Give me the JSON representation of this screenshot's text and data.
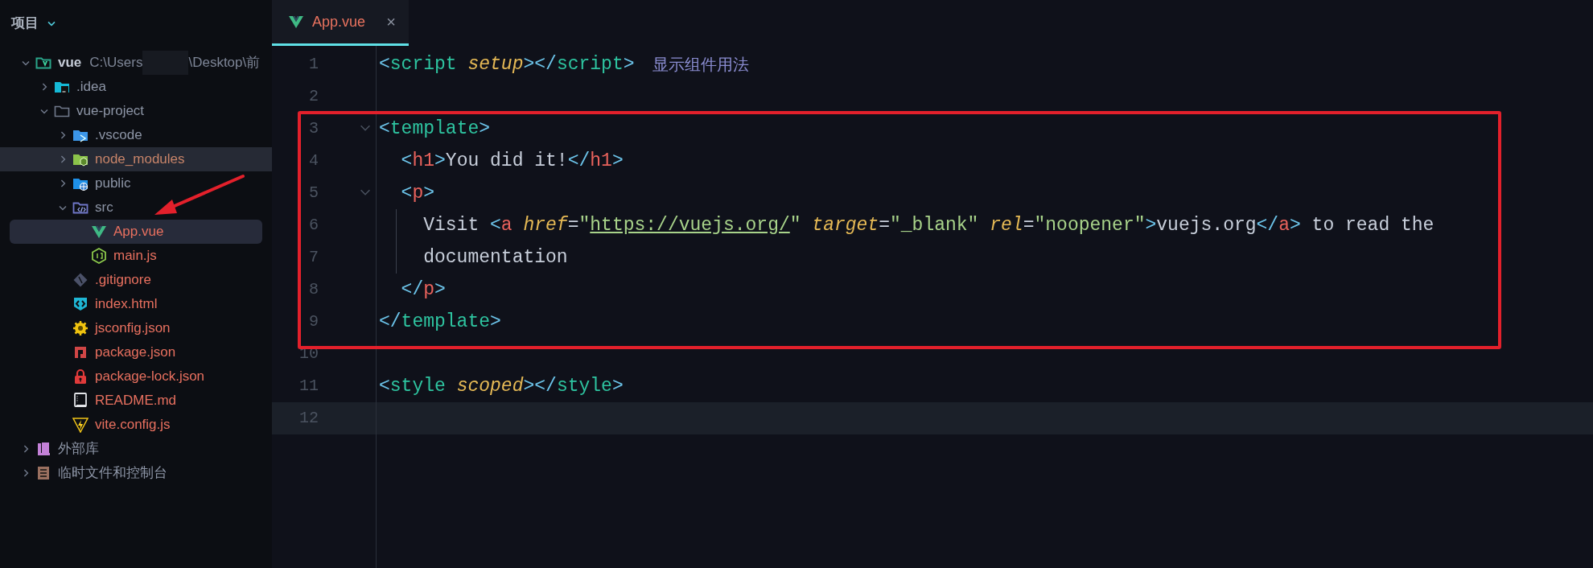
{
  "sidebar": {
    "header": {
      "title": "项目",
      "expanded": true
    },
    "tree": [
      {
        "kind": "module",
        "label": "vue",
        "path_start": "C:\\Users",
        "path_end": "\\Desktop\\前",
        "expanded": true,
        "selected": false,
        "hovered": false,
        "color": "#c4cad6",
        "children": [
          {
            "kind": "ideafolder",
            "label": ".idea",
            "expanded": false,
            "selected": false,
            "hovered": false,
            "color": "#8d95a6"
          },
          {
            "kind": "folder",
            "label": "vue-project",
            "expanded": true,
            "selected": false,
            "hovered": false,
            "color": "#8d95a6",
            "children": [
              {
                "kind": "vscodefolder",
                "label": ".vscode",
                "expanded": false,
                "selected": false,
                "hovered": false,
                "color": "#8d95a6"
              },
              {
                "kind": "nodefolder",
                "label": "node_modules",
                "expanded": false,
                "selected": false,
                "hovered": true,
                "color": "#c78469"
              },
              {
                "kind": "webfolder",
                "label": "public",
                "expanded": false,
                "selected": false,
                "hovered": false,
                "color": "#8d95a6"
              },
              {
                "kind": "srcfolder",
                "label": "src",
                "expanded": true,
                "selected": false,
                "hovered": false,
                "color": "#8d95a6",
                "children": [
                  {
                    "kind": "vue",
                    "label": "App.vue",
                    "selected": true,
                    "color": "#e8705f"
                  },
                  {
                    "kind": "js",
                    "label": "main.js",
                    "selected": false,
                    "hovered": false,
                    "color": "#e8705f"
                  }
                ]
              },
              {
                "kind": "git",
                "label": ".gitignore",
                "selected": false,
                "hovered": false,
                "color": "#e8705f"
              },
              {
                "kind": "html",
                "label": "index.html",
                "selected": false,
                "hovered": false,
                "color": "#e8705f"
              },
              {
                "kind": "jsconfig",
                "label": "jsconfig.json",
                "selected": false,
                "hovered": false,
                "color": "#e8705f"
              },
              {
                "kind": "npm",
                "label": "package.json",
                "selected": false,
                "hovered": false,
                "color": "#e8705f"
              },
              {
                "kind": "lock",
                "label": "package-lock.json",
                "selected": false,
                "hovered": false,
                "color": "#e8705f"
              },
              {
                "kind": "readme",
                "label": "README.md",
                "selected": false,
                "hovered": false,
                "color": "#e8705f"
              },
              {
                "kind": "vite",
                "label": "vite.config.js",
                "selected": false,
                "hovered": false,
                "color": "#e8705f"
              }
            ]
          }
        ]
      },
      {
        "kind": "library",
        "label": "外部库",
        "expanded": false,
        "selected": false,
        "hovered": false,
        "color": "#8d95a6"
      },
      {
        "kind": "scratches",
        "label": "临时文件和控制台",
        "expanded": false,
        "selected": false,
        "hovered": false,
        "color": "#8d95a6"
      }
    ]
  },
  "tabs": [
    {
      "label": "App.vue",
      "close": "×",
      "selected": true
    }
  ],
  "editor": {
    "lines": [
      {
        "number": "1",
        "tokens": [
          {
            "kind": "bracket",
            "text": "<"
          },
          {
            "kind": "tag",
            "text": "script "
          },
          {
            "kind": "attr",
            "text": "setup"
          },
          {
            "kind": "bracket",
            "text": "></"
          },
          {
            "kind": "tag",
            "text": "script"
          },
          {
            "kind": "bracket",
            "text": ">"
          }
        ],
        "hint": "显示组件用法"
      },
      {
        "number": "2"
      },
      {
        "number": "3",
        "fold": true,
        "tokens": [
          {
            "kind": "bracket",
            "text": "<"
          },
          {
            "kind": "tag",
            "text": "template"
          },
          {
            "kind": "bracket",
            "text": ">"
          }
        ]
      },
      {
        "number": "4",
        "tokens": [
          {
            "kind": "bracket",
            "text": "  <"
          },
          {
            "kind": "htmltag",
            "text": "h1"
          },
          {
            "kind": "bracket",
            "text": ">"
          },
          {
            "kind": "text",
            "text": "You did it!"
          },
          {
            "kind": "bracket",
            "text": "</"
          },
          {
            "kind": "htmltag",
            "text": "h1"
          },
          {
            "kind": "bracket",
            "text": ">"
          }
        ]
      },
      {
        "number": "5",
        "fold": true,
        "tokens": [
          {
            "kind": "bracket",
            "text": "  <"
          },
          {
            "kind": "htmltag",
            "text": "p"
          },
          {
            "kind": "bracket",
            "text": ">"
          }
        ]
      },
      {
        "number": "6",
        "indent_guide": true,
        "tokens": [
          {
            "kind": "text",
            "text": "    Visit "
          },
          {
            "kind": "bracket",
            "text": "<"
          },
          {
            "kind": "htmltag",
            "text": "a "
          },
          {
            "kind": "attr",
            "text": "href"
          },
          {
            "kind": "text",
            "text": "="
          },
          {
            "kind": "string",
            "text": "\""
          },
          {
            "kind": "url",
            "text": "https://vuejs.org/"
          },
          {
            "kind": "string",
            "text": "\" "
          },
          {
            "kind": "attr",
            "text": "target"
          },
          {
            "kind": "text",
            "text": "="
          },
          {
            "kind": "string",
            "text": "\"_blank\" "
          },
          {
            "kind": "attr",
            "text": "rel"
          },
          {
            "kind": "text",
            "text": "="
          },
          {
            "kind": "string",
            "text": "\"noopener\""
          },
          {
            "kind": "bracket",
            "text": ">"
          },
          {
            "kind": "text",
            "text": "vuejs.org"
          },
          {
            "kind": "bracket",
            "text": "</"
          },
          {
            "kind": "htmltag",
            "text": "a"
          },
          {
            "kind": "bracket",
            "text": ">"
          },
          {
            "kind": "text",
            "text": " to read the"
          }
        ]
      },
      {
        "number": "7",
        "indent_guide": true,
        "tokens": [
          {
            "kind": "text",
            "text": "    documentation"
          }
        ]
      },
      {
        "number": "8",
        "tokens": [
          {
            "kind": "bracket",
            "text": "  </"
          },
          {
            "kind": "htmltag",
            "text": "p"
          },
          {
            "kind": "bracket",
            "text": ">"
          }
        ]
      },
      {
        "number": "9",
        "tokens": [
          {
            "kind": "bracket",
            "text": "</"
          },
          {
            "kind": "tag",
            "text": "template"
          },
          {
            "kind": "bracket",
            "text": ">"
          }
        ]
      },
      {
        "number": "10"
      },
      {
        "number": "11",
        "tokens": [
          {
            "kind": "bracket",
            "text": "<"
          },
          {
            "kind": "tag",
            "text": "style "
          },
          {
            "kind": "attr",
            "text": "scoped"
          },
          {
            "kind": "bracket",
            "text": "></"
          },
          {
            "kind": "tag",
            "text": "style"
          },
          {
            "kind": "bracket",
            "text": ">"
          }
        ]
      },
      {
        "number": "12",
        "current": true
      }
    ]
  }
}
